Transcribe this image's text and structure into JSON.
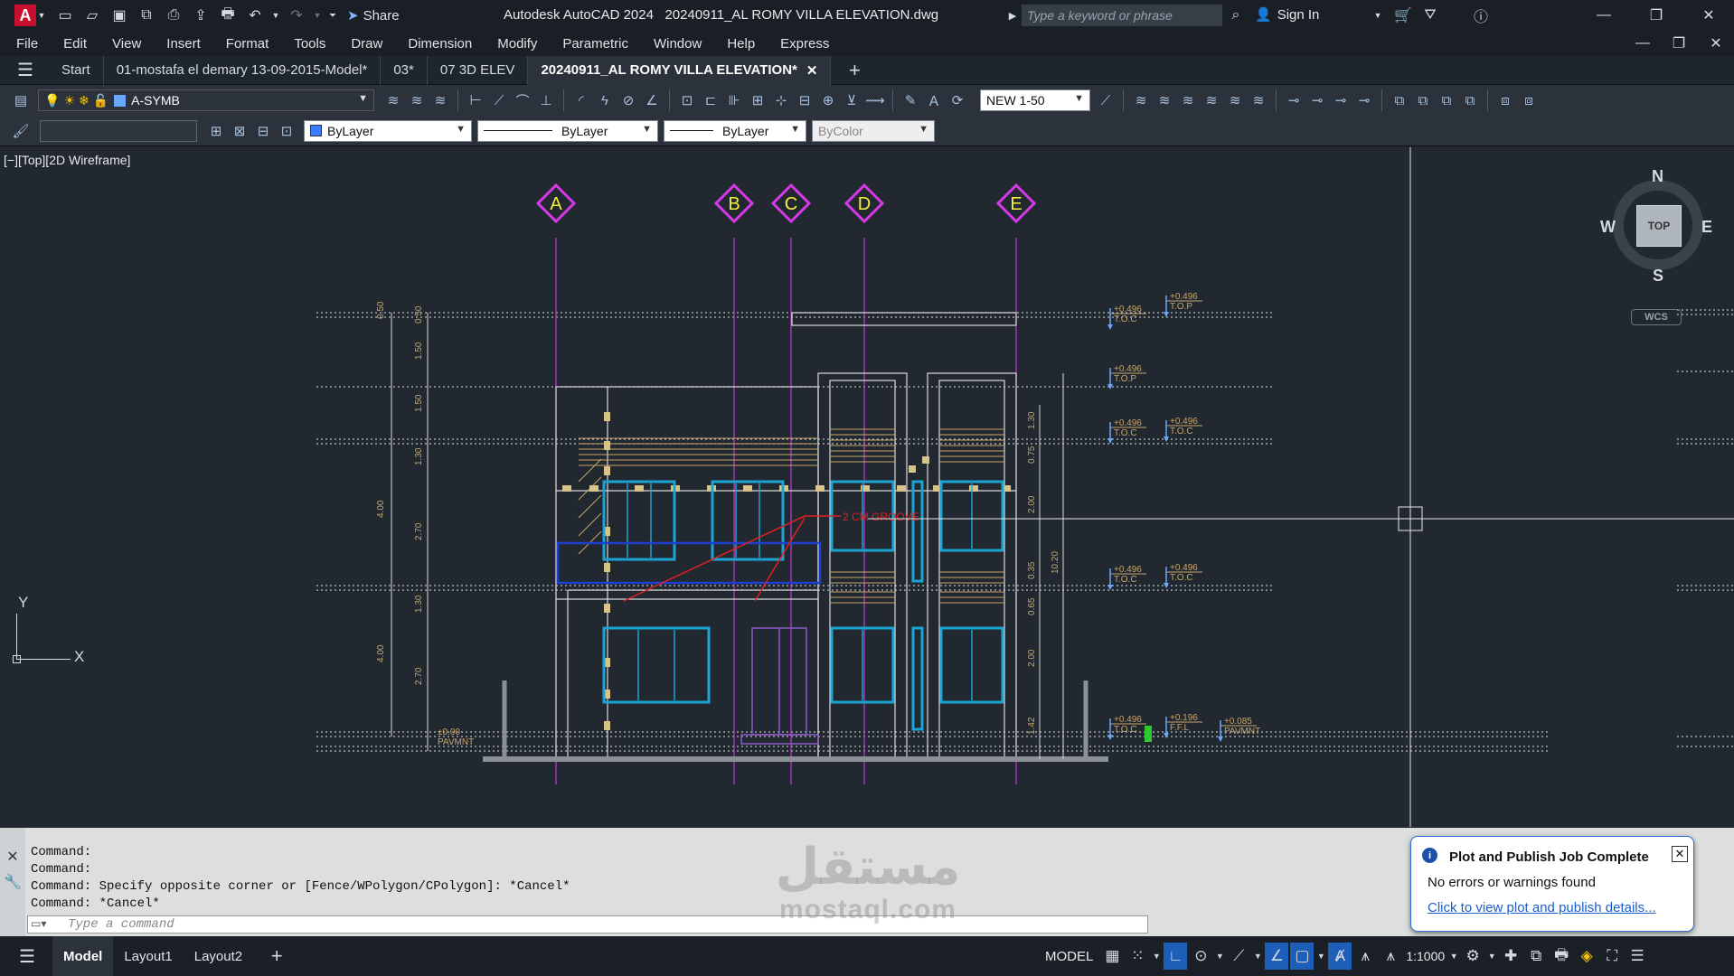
{
  "app": {
    "title": "Autodesk AutoCAD 2024",
    "file": "20240911_AL ROMY VILLA ELEVATION.dwg",
    "logo": "A",
    "share": "Share",
    "search_placeholder": "Type a keyword or phrase",
    "sign_in": "Sign In"
  },
  "menu": [
    "File",
    "Edit",
    "View",
    "Insert",
    "Format",
    "Tools",
    "Draw",
    "Dimension",
    "Modify",
    "Parametric",
    "Window",
    "Help",
    "Express"
  ],
  "tabs": [
    {
      "label": "Start"
    },
    {
      "label": "01-mostafa el demary 13-09-2015-Model*"
    },
    {
      "label": "03*"
    },
    {
      "label": "07 3D ELEV"
    },
    {
      "label": "20240911_AL ROMY VILLA ELEVATION*",
      "active": true
    }
  ],
  "toolbar": {
    "layer": "A-SYMB",
    "scale": "NEW 1-50",
    "color": "ByLayer",
    "linetype": "ByLayer",
    "lineweight": "ByLayer",
    "plotstyle": "ByColor"
  },
  "viewport": {
    "label": "[−][Top][2D Wireframe]",
    "compass": {
      "n": "N",
      "s": "S",
      "e": "E",
      "w": "W",
      "top": "TOP",
      "wcs": "WCS"
    },
    "ucs": {
      "x": "X",
      "y": "Y"
    }
  },
  "drawing": {
    "grid_labels": [
      "A",
      "B",
      "C",
      "D",
      "E"
    ],
    "left_dims_outer": [
      "0.50",
      "4.00",
      "4.00"
    ],
    "left_dims_inner": [
      "0.50",
      "1.50",
      "1.50",
      "1.30",
      "2.70",
      "1.30",
      "2.70"
    ],
    "right_dims_inner": [
      "1.30",
      "0.75",
      "2.00",
      "0.35",
      "0.65",
      "2.00",
      "1.42"
    ],
    "right_dim_total": "10.20",
    "annotation": "2 CM GROOVE",
    "levels": [
      {
        "value": "+0.496",
        "label": "T.O.C"
      },
      {
        "value": "+0.496",
        "label": "T.O.P"
      },
      {
        "value": "+0.496",
        "label": "T.O.P"
      },
      {
        "value": "+0.496",
        "label": "T.O.C"
      },
      {
        "value": "+0.496",
        "label": "T.O.C"
      },
      {
        "value": "+0.496",
        "label": "T.O.C"
      },
      {
        "value": "+0.496",
        "label": "T.O.C"
      },
      {
        "value": "+0.496",
        "label": "T.O.C"
      },
      {
        "value": "+0.196",
        "label": "F.F.L"
      },
      {
        "value": "+0.085",
        "label": "PAVMNT"
      }
    ],
    "ground": {
      "value": "±0.00",
      "label": "PAVMNT"
    }
  },
  "command": {
    "history": [
      "Command:",
      "Command:",
      "Command: Specify opposite corner or [Fence/WPolygon/CPolygon]: *Cancel*",
      "Command: *Cancel*"
    ],
    "placeholder": "Type a command"
  },
  "notification": {
    "title": "Plot and Publish Job Complete",
    "message": "No errors or warnings found",
    "link": "Click to view plot and publish details..."
  },
  "status": {
    "tabs": [
      "Model",
      "Layout1",
      "Layout2"
    ],
    "mode": "MODEL",
    "scale": "1:1000"
  },
  "watermark": {
    "arabic": "مستقل",
    "latin": "mostaql.com"
  }
}
